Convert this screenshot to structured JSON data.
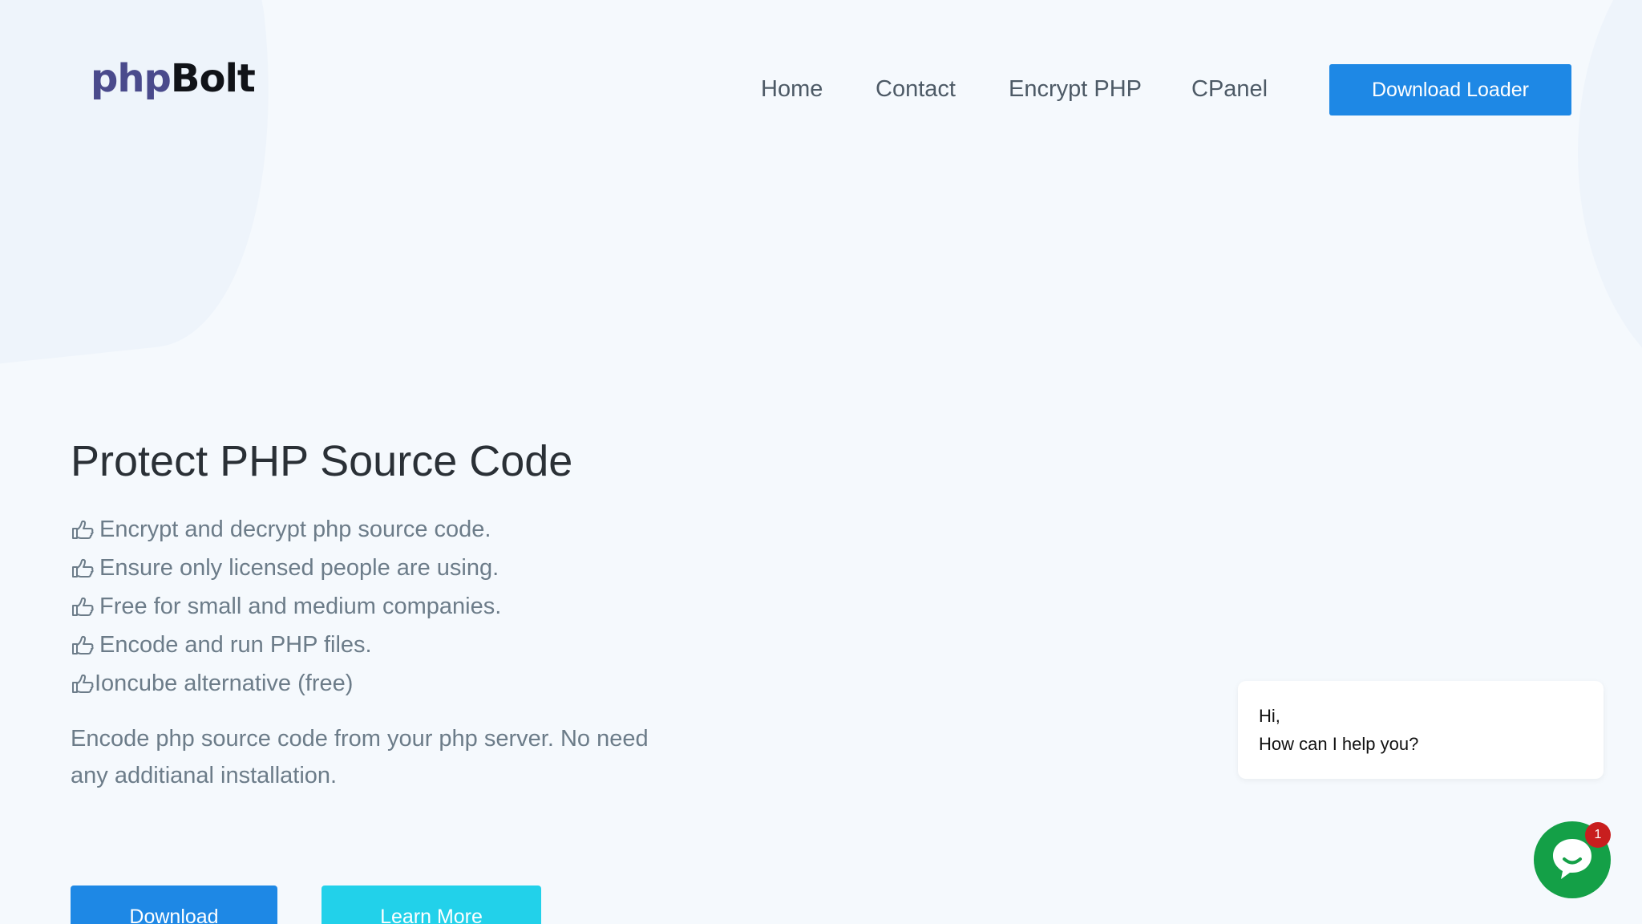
{
  "header": {
    "logo": {
      "part1": "php",
      "part2": "Bolt"
    },
    "nav": [
      {
        "label": "Home"
      },
      {
        "label": "Contact"
      },
      {
        "label": "Encrypt PHP"
      },
      {
        "label": "CPanel"
      }
    ],
    "cta_label": "Download Loader"
  },
  "hero": {
    "title": "Protect PHP Source Code",
    "features": [
      "Encrypt and decrypt php source code.",
      "Ensure only licensed people are using.",
      "Free for small and medium companies.",
      "Encode and run PHP files.",
      "Ioncube alternative (free)"
    ],
    "feature_icon": "thumbs-up-icon",
    "description": "Encode php source code from your php server. No need any additianal installation.",
    "buttons": {
      "download": "Download",
      "learn_more": "Learn More"
    }
  },
  "chat": {
    "greeting": "Hi,",
    "message": "How can I help you?",
    "badge_count": "1",
    "icon": "chat-icon"
  },
  "colors": {
    "background": "#f5f9fd",
    "primary": "#1e88e5",
    "accent": "#22d1ea",
    "chat_green": "#14a047",
    "badge_red": "#c81e1e",
    "logo_php": "#4a4a8c"
  }
}
